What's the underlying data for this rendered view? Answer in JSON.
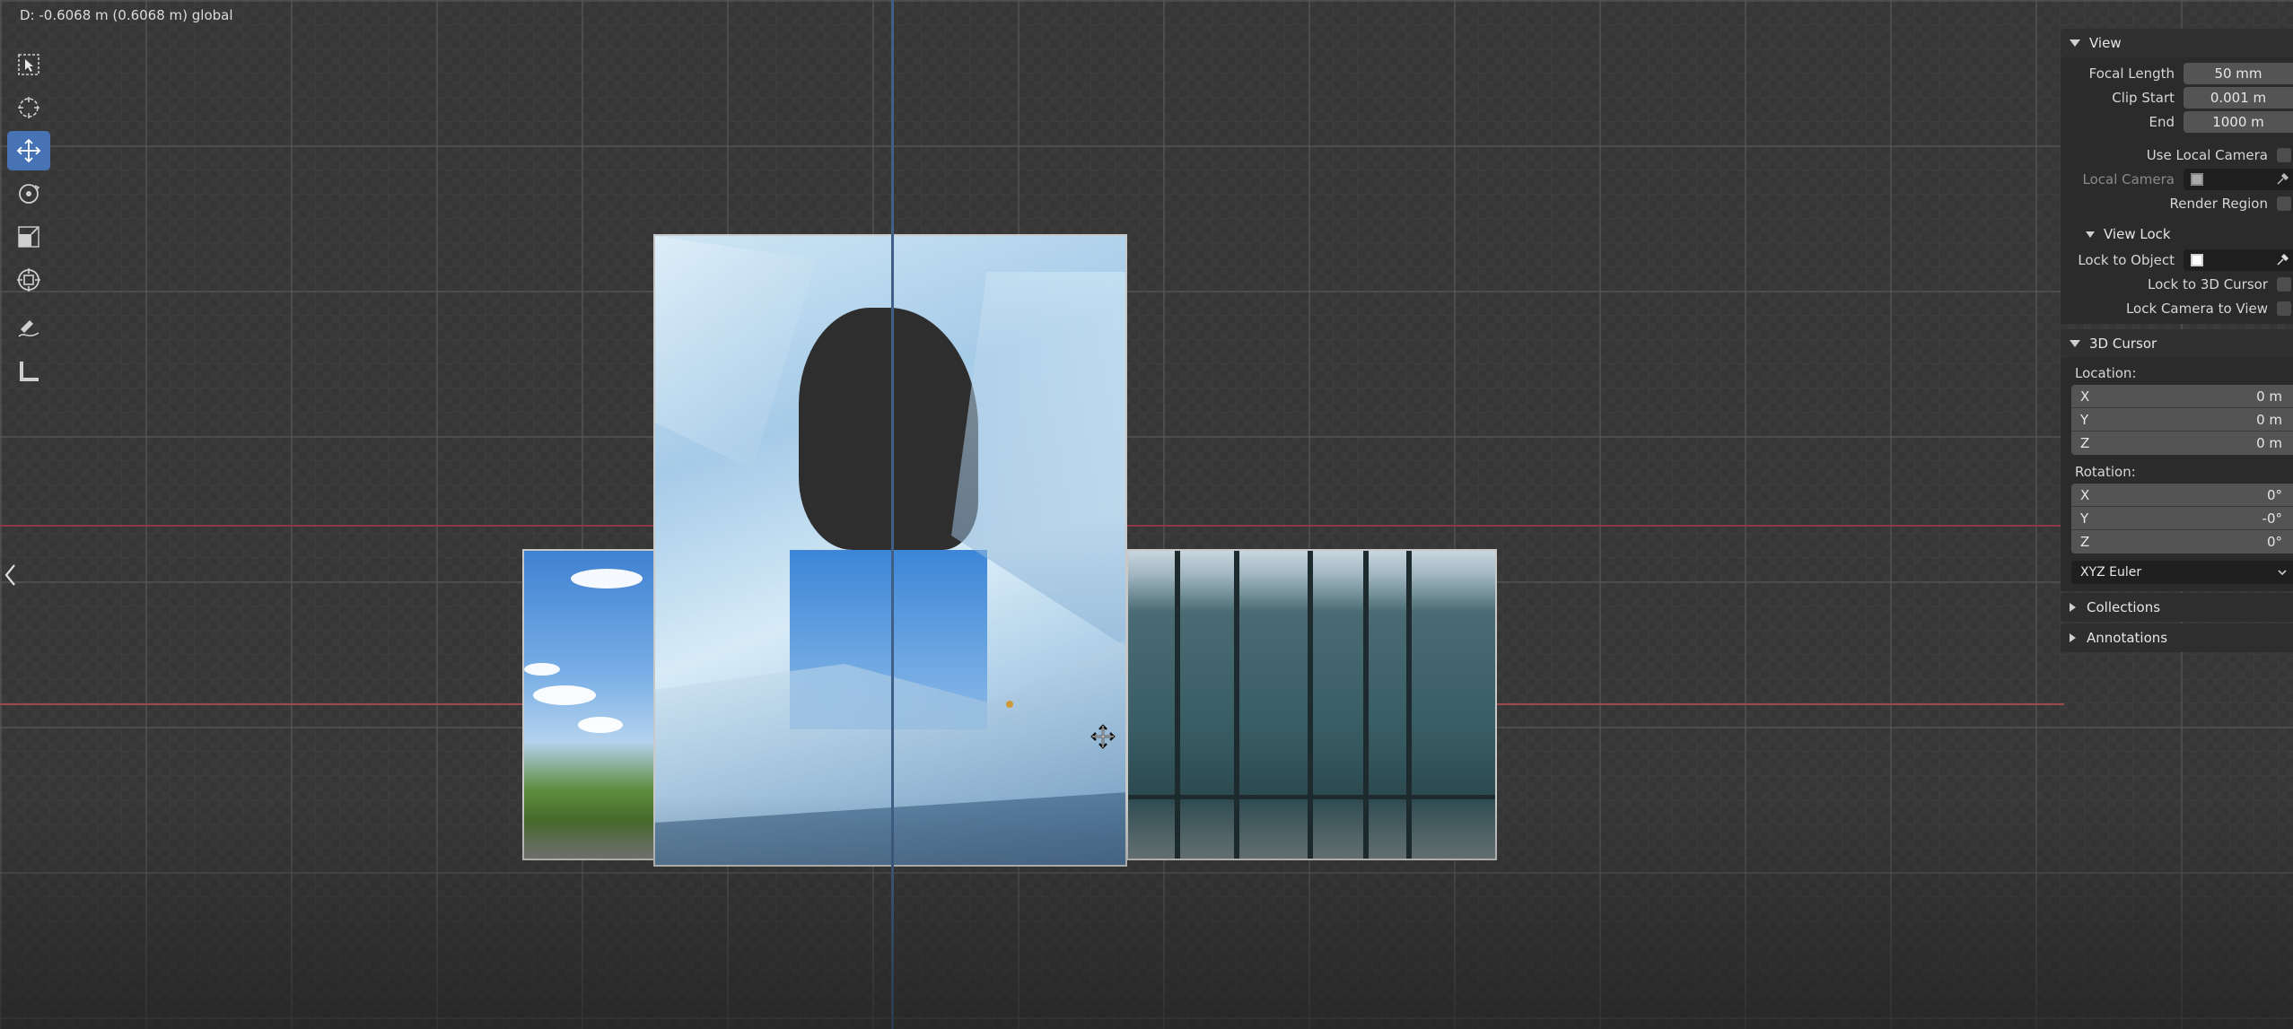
{
  "status": {
    "text": "D: -0.6068 m (0.6068 m) global"
  },
  "toolbar": {
    "tools": [
      {
        "name": "select-box",
        "active": false
      },
      {
        "name": "cursor",
        "active": false
      },
      {
        "name": "move",
        "active": true
      },
      {
        "name": "rotate",
        "active": false
      },
      {
        "name": "scale",
        "active": false
      },
      {
        "name": "transform",
        "active": false
      },
      {
        "name": "annotate",
        "active": false
      },
      {
        "name": "measure",
        "active": false
      }
    ]
  },
  "colors": {
    "accent": "#4772b3",
    "axis_x": "#8a3b42",
    "axis_y": "#3f5f86",
    "panel_bg": "#2b2b2b",
    "field_bg": "#545454"
  },
  "panel": {
    "view": {
      "title": "View",
      "focal_length_label": "Focal Length",
      "focal_length_value": "50 mm",
      "clip_start_label": "Clip Start",
      "clip_start_value": "0.001 m",
      "end_label": "End",
      "end_value": "1000 m",
      "use_local_camera_label": "Use Local Camera",
      "local_camera_label": "Local Camera",
      "render_region_label": "Render Region"
    },
    "view_lock": {
      "title": "View Lock",
      "lock_to_object_label": "Lock to Object",
      "lock_to_3d_cursor_label": "Lock to 3D Cursor",
      "lock_camera_to_view_label": "Lock Camera to View"
    },
    "cursor_3d": {
      "title": "3D Cursor",
      "location_label": "Location:",
      "location": [
        {
          "axis": "X",
          "value": "0 m"
        },
        {
          "axis": "Y",
          "value": "0 m"
        },
        {
          "axis": "Z",
          "value": "0 m"
        }
      ],
      "rotation_label": "Rotation:",
      "rotation": [
        {
          "axis": "X",
          "value": "0°"
        },
        {
          "axis": "Y",
          "value": "-0°"
        },
        {
          "axis": "Z",
          "value": "0°"
        }
      ],
      "rotation_mode": "XYZ Euler"
    },
    "collections_label": "Collections",
    "annotations_label": "Annotations"
  }
}
